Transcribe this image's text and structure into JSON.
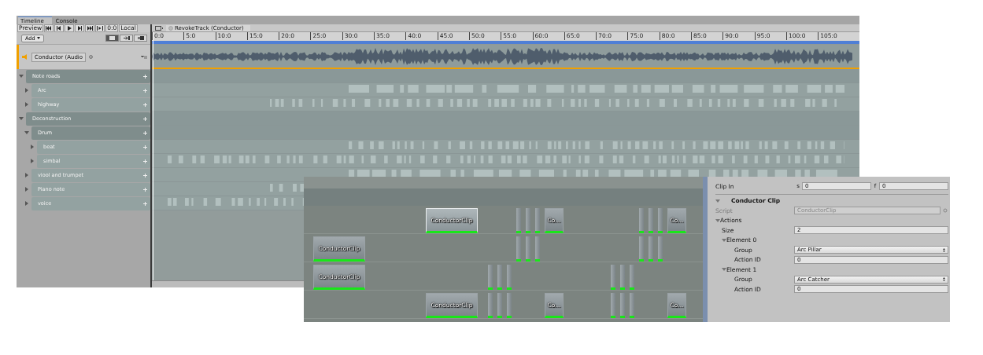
{
  "window": {
    "tabs": [
      {
        "label": "Timeline",
        "selected": true
      },
      {
        "label": "Console",
        "selected": false
      }
    ]
  },
  "toolbar": {
    "preview": "Preview",
    "frame": "0:0",
    "local": "Local",
    "add": "Add"
  },
  "breadcrumb": "RevokeTrack (Conductor)",
  "ruler": {
    "labels": [
      "0:0",
      "5:0",
      "10:0",
      "15:0",
      "20:0",
      "25:0",
      "30:0",
      "35:0",
      "40:0",
      "45:0",
      "50:0",
      "55:0",
      "60:0",
      "65:0",
      "70:0",
      "75:0",
      "80:0",
      "85:0",
      "90:0",
      "95:0",
      "100:0",
      "105:0"
    ]
  },
  "conductor_track": {
    "name": "Conductor (Audio"
  },
  "tracks": [
    {
      "name": "Note roads",
      "expanded": true,
      "children": [
        {
          "name": "Arc",
          "expanded": false
        },
        {
          "name": "highway",
          "expanded": false
        }
      ]
    },
    {
      "name": "Deconstruction",
      "expanded": true,
      "children": [
        {
          "name": "Drum",
          "expanded": true,
          "children": [
            {
              "name": "beat",
              "expanded": false
            },
            {
              "name": "simbal",
              "expanded": false
            }
          ]
        },
        {
          "name": "viool and trumpet",
          "expanded": false
        },
        {
          "name": "Piano note",
          "expanded": false
        },
        {
          "name": "voice",
          "expanded": false
        }
      ]
    }
  ],
  "clip_editor": {
    "lanes": [
      {
        "clips": [
          {
            "kind": "clip",
            "label": "ConductorClip",
            "selected": true
          },
          {
            "kind": "pillar"
          },
          {
            "kind": "pillar"
          },
          {
            "kind": "pillar"
          },
          {
            "kind": "clip",
            "label": "Co...",
            "selected": false
          },
          {
            "kind": "pillar"
          },
          {
            "kind": "pillar"
          },
          {
            "kind": "pillar"
          },
          {
            "kind": "clip",
            "label": "Co...",
            "selected": false
          }
        ]
      },
      {
        "clips": [
          {
            "kind": "clip",
            "label": "ConductorClip",
            "selected": false
          },
          {
            "kind": "pillar"
          },
          {
            "kind": "pillar"
          },
          {
            "kind": "pillar"
          },
          {
            "kind": "pillar"
          },
          {
            "kind": "pillar"
          },
          {
            "kind": "pillar"
          }
        ]
      },
      {
        "clips": [
          {
            "kind": "clip",
            "label": "ConductorClip",
            "selected": false
          },
          {
            "kind": "pillar"
          },
          {
            "kind": "pillar"
          },
          {
            "kind": "pillar"
          },
          {
            "kind": "pillar"
          },
          {
            "kind": "pillar"
          },
          {
            "kind": "pillar"
          }
        ]
      },
      {
        "clips": [
          {
            "kind": "clip",
            "label": "ConductorClip",
            "selected": false
          },
          {
            "kind": "pillar"
          },
          {
            "kind": "pillar"
          },
          {
            "kind": "pillar"
          },
          {
            "kind": "clip",
            "label": "Co...",
            "selected": false
          },
          {
            "kind": "pillar"
          },
          {
            "kind": "pillar"
          },
          {
            "kind": "pillar"
          },
          {
            "kind": "clip",
            "label": "Co...",
            "selected": false
          }
        ]
      }
    ]
  },
  "inspector": {
    "clip_in": {
      "label": "Clip In",
      "s_label": "s",
      "s_value": "0",
      "f_label": "f",
      "f_value": "0"
    },
    "section": {
      "title": "Conductor Clip",
      "expanded": true
    },
    "script": {
      "label": "Script",
      "value": "ConductorClip",
      "disabled": true
    },
    "actions": {
      "label": "Actions",
      "expanded": true,
      "size_label": "Size",
      "size": "2",
      "elements": [
        {
          "label": "Element 0",
          "expanded": true,
          "fields": [
            {
              "kind": "dropdown",
              "label": "Group",
              "value": "Arc Pillar"
            },
            {
              "kind": "text",
              "label": "Action ID",
              "value": "0"
            }
          ]
        },
        {
          "label": "Element 1",
          "expanded": true,
          "fields": [
            {
              "kind": "dropdown",
              "label": "Group",
              "value": "Arc Catcher"
            },
            {
              "kind": "text",
              "label": "Action ID",
              "value": "0"
            }
          ]
        }
      ]
    }
  }
}
